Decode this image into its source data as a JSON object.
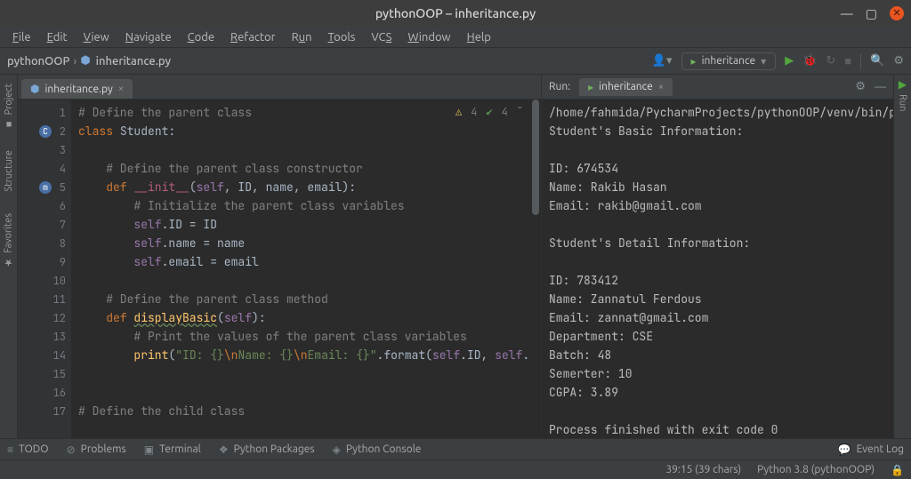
{
  "window": {
    "title": "pythonOOP – inheritance.py"
  },
  "menu": [
    "File",
    "Edit",
    "View",
    "Navigate",
    "Code",
    "Refactor",
    "Run",
    "Tools",
    "VCS",
    "Window",
    "Help"
  ],
  "breadcrumbs": {
    "project": "pythonOOP",
    "file": "inheritance.py"
  },
  "run_config": "inheritance",
  "editor": {
    "tab_label": "inheritance.py",
    "inspections": {
      "warnings": "4",
      "weak": "4"
    },
    "gutter_marks": {
      "2": "C",
      "5": "m"
    },
    "lines": [
      1,
      2,
      3,
      4,
      5,
      6,
      7,
      8,
      9,
      10,
      11,
      12,
      13,
      14,
      15,
      16,
      17
    ],
    "code": {
      "l1": "# Define the parent class",
      "l2_kw": "class ",
      "l2_name": "Student:",
      "l4": "    # Define the parent class constructor",
      "l5_def": "    def ",
      "l5_fn": "__init__",
      "l5_args_open": "(",
      "l5_self": "self",
      "l5_args_rest": ", ID, name, email):",
      "l6": "        # Initialize the parent class variables",
      "l7a": "        ",
      "l7_self": "self",
      "l7b": ".ID = ID",
      "l8_self": "self",
      "l8b": ".name = name",
      "l9_self": "self",
      "l9b": ".email = email",
      "l11": "    # Define the parent class method",
      "l12_def": "    def ",
      "l12_fn": "displayBasic",
      "l12_open": "(",
      "l12_self": "self",
      "l12_close": "):",
      "l13": "        # Print the values of the parent class variables",
      "l14_a": "        ",
      "l14_print": "print",
      "l14_p1": "(",
      "l14_str1": "\"ID: ",
      "l14_br1": "{}",
      "l14_esc1": "\\n",
      "l14_str2": "Name: ",
      "l14_br2": "{}",
      "l14_esc2": "\\n",
      "l14_str3": "Email: ",
      "l14_br3": "{}",
      "l14_strend": "\"",
      "l14_fmt": ".format(",
      "l14_self1": "self",
      "l14_d1": ".ID, ",
      "l14_self2": "self",
      "l14_d2": ".name, ",
      "l17": "# Define the child class"
    }
  },
  "run": {
    "label": "Run:",
    "tab": "inheritance",
    "output": "/home/fahmida/PycharmProjects/pythonOOP/venv/bin/p\nStudent's Basic Information:\n\nID: 674534\nName: Rakib Hasan\nEmail: rakib@gmail.com\n\nStudent's Detail Information:\n\nID: 783412\nName: Zannatul Ferdous\nEmail: zannat@gmail.com\nDepartment: CSE\nBatch: 48\nSemerter: 10\nCGPA: 3.89\n\nProcess finished with exit code 0"
  },
  "left_strip": [
    "Project",
    "Structure",
    "Favorites"
  ],
  "right_strip": [
    "Run"
  ],
  "bottom_tools": [
    "TODO",
    "Problems",
    "Terminal",
    "Python Packages",
    "Python Console"
  ],
  "bottom_right": "Event Log",
  "status": {
    "pos": "39:15 (39 chars)",
    "sdk": "Python 3.8 (pythonOOP)"
  }
}
